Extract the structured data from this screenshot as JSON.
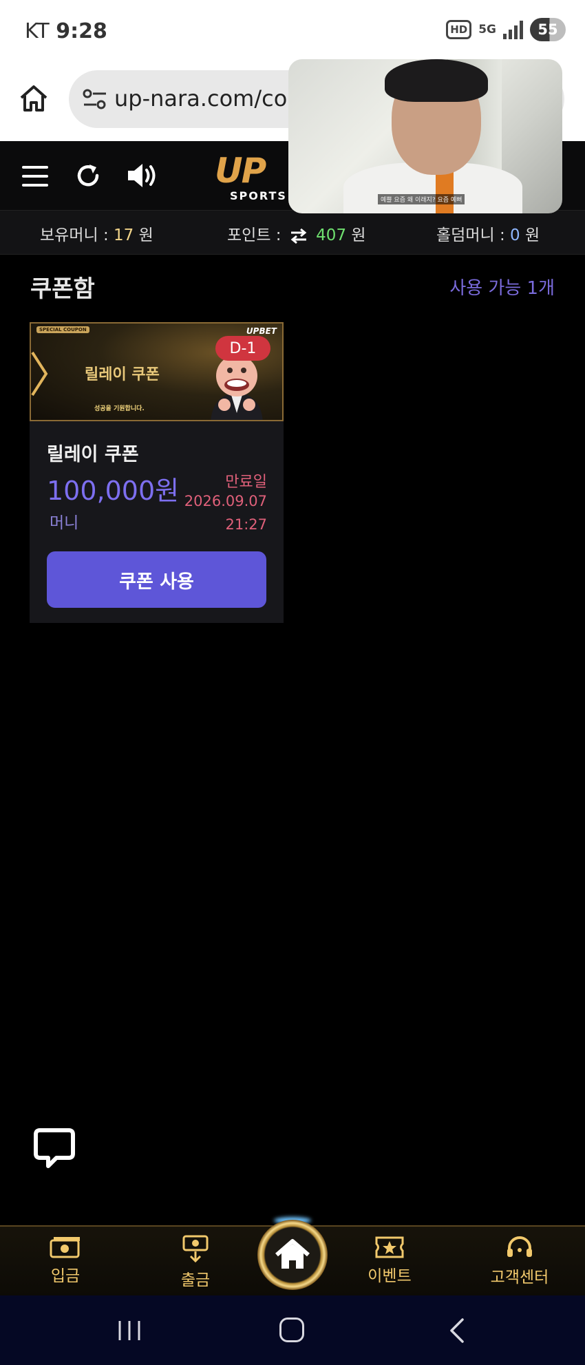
{
  "status_bar": {
    "carrier": "KT",
    "time": "9:28",
    "hd": "HD",
    "network": "5G",
    "battery": "55"
  },
  "browser": {
    "url": "up-nara.com/cou"
  },
  "pip_video": {
    "subtitle": "예쁠 요즘 왜 이래지? 요즘 예뻐"
  },
  "app": {
    "logo_main": "UP",
    "logo_sub": "SPORTS"
  },
  "money_bar": {
    "holding_label": "보유머니 :",
    "holding_value": "17",
    "holding_unit": "원",
    "point_label": "포인트 :",
    "point_value": "407",
    "point_unit": "원",
    "holdem_label": "홀덤머니 :",
    "holdem_value": "0",
    "holdem_unit": "원"
  },
  "main": {
    "title": "쿠폰함",
    "available": "사용 가능 1개"
  },
  "coupon": {
    "banner_tag": "SPECIAL COUPON",
    "banner_brand": "UPBET",
    "banner_title": "릴레이 쿠폰",
    "banner_sub": "성공을 기원합니다.",
    "dday": "D-1",
    "name": "릴레이 쿠폰",
    "amount": "100,000원",
    "type": "머니",
    "expire_label": "만료일",
    "expire_date": "2026.09.07",
    "expire_time": "21:27",
    "use_label": "쿠폰 사용"
  },
  "bottom_nav": {
    "deposit": "입금",
    "withdraw": "출금",
    "event": "이벤트",
    "support": "고객센터"
  },
  "colors": {
    "accent": "#5e56d8",
    "gold": "#f2c96c",
    "expire": "#e0607a",
    "point_green": "#6fe06f"
  }
}
